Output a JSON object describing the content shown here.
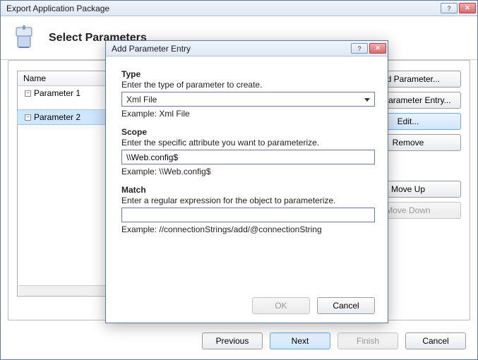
{
  "mainWindow": {
    "title": "Export Application Package",
    "headerTitle": "Select Parameters"
  },
  "table": {
    "header": "Name",
    "rows": [
      {
        "label": "Parameter 1",
        "selected": false
      },
      {
        "label": "Parameter 2",
        "selected": true
      }
    ]
  },
  "sideButtons": {
    "addParameter": "Add Parameter...",
    "addEntry": "Add Parameter Entry...",
    "edit": "Edit...",
    "remove": "Remove",
    "moveUp": "Move Up",
    "moveDown": "Move Down"
  },
  "footer": {
    "previous": "Previous",
    "next": "Next",
    "finish": "Finish",
    "cancel": "Cancel"
  },
  "dialog": {
    "title": "Add Parameter Entry",
    "type": {
      "label": "Type",
      "desc": "Enter the type of parameter to create.",
      "value": "Xml File",
      "example": "Example: Xml File"
    },
    "scope": {
      "label": "Scope",
      "desc": "Enter the specific attribute you want to parameterize.",
      "value": "\\\\Web.config$",
      "example": "Example: \\\\Web.config$"
    },
    "match": {
      "label": "Match",
      "desc": "Enter a regular expression for the object to parameterize.",
      "value": "",
      "example": "Example: //connectionStrings/add/@connectionString"
    },
    "ok": "OK",
    "cancel": "Cancel"
  }
}
